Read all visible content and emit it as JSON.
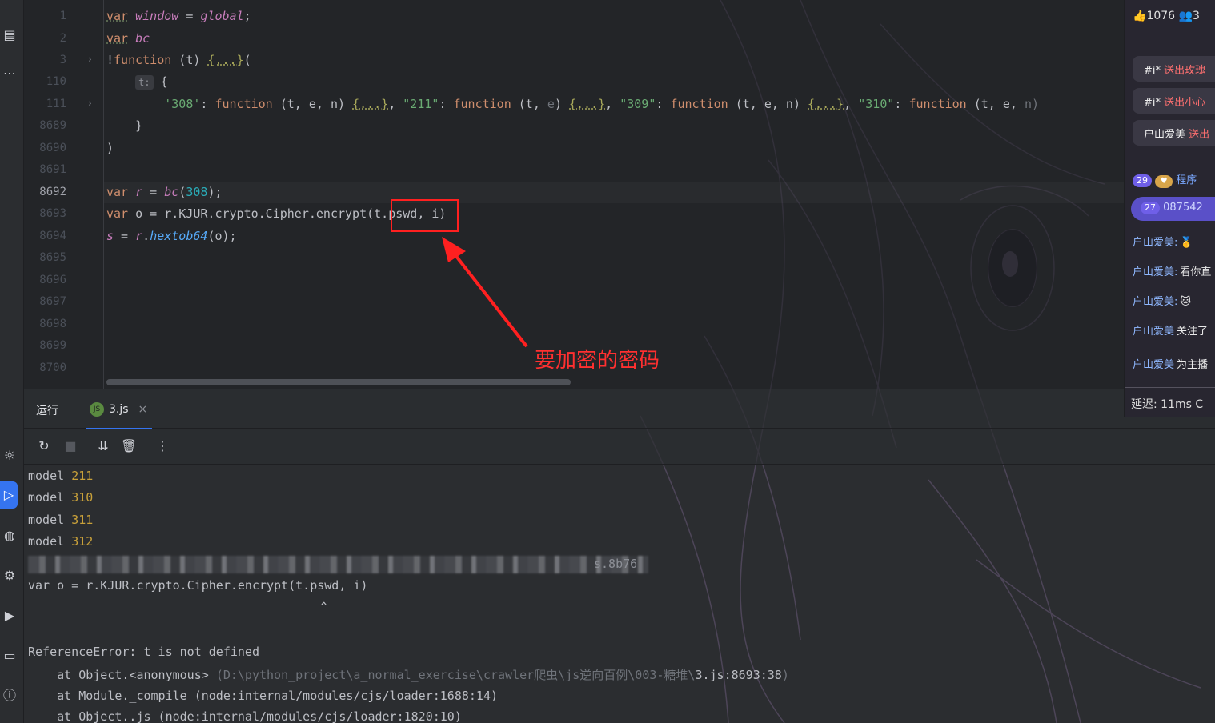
{
  "editor": {
    "lines": [
      {
        "num": "1"
      },
      {
        "num": "2"
      },
      {
        "num": "3"
      },
      {
        "num": "110"
      },
      {
        "num": "111"
      },
      {
        "num": "8689"
      },
      {
        "num": "8690"
      },
      {
        "num": "8691"
      },
      {
        "num": "8692"
      },
      {
        "num": "8693"
      },
      {
        "num": "8694"
      },
      {
        "num": "8695"
      },
      {
        "num": "8696"
      },
      {
        "num": "8697"
      },
      {
        "num": "8698"
      },
      {
        "num": "8699"
      },
      {
        "num": "8700"
      }
    ],
    "code": {
      "l1_kw": "var",
      "l1_name": "window",
      "l1_eq": " = ",
      "l1_val": "global",
      "l1_end": ";",
      "l2_kw": "var",
      "l2_name": "bc",
      "l3_start": "!",
      "l3_kw": "function",
      "l3_args": " (t) ",
      "l3_fold": "{...}",
      "l3_end": "(",
      "l110_hint": "t:",
      "l110_brace": "{",
      "l111_k1": "'308'",
      "l111_s1": ": ",
      "l111_f1": "function",
      "l111_a1": " (t, e, n) ",
      "l111_b1": "{...}",
      "l111_k2": "\"211\"",
      "l111_f2": "function",
      "l111_a2": " (t, ",
      "l111_e2": "e",
      "l111_a2b": ") ",
      "l111_b2": "{...}",
      "l111_k3": "\"309\"",
      "l111_f3": "function",
      "l111_a3": " (t, e, n) ",
      "l111_b3": "{...}",
      "l111_k4": "\"310\"",
      "l111_f4": "function",
      "l111_a4": " (t, e, ",
      "l111_n4": "n)",
      "l8689": "}",
      "l8690": ")",
      "l8692_kw": "var",
      "l8692_r": "r",
      "l8692_eq": " = ",
      "l8692_fn": "bc",
      "l8692_o": "(",
      "l8692_num": "308",
      "l8692_c": ");",
      "l8693_kw": "var",
      "l8693_rest": " o = r.KJUR.crypto.Cipher.encrypt(t.pswd, i)",
      "l8694_s": "s",
      "l8694_eq": " = ",
      "l8694_r": "r",
      "l8694_dot": ".",
      "l8694_fn": "hextob64",
      "l8694_end": "(o);"
    }
  },
  "annotation": {
    "text": "要加密的密码"
  },
  "run_panel": {
    "title": "运行",
    "tab_icon": "JS",
    "tab_label": "3.js",
    "close": "×"
  },
  "console": {
    "models": [
      {
        "label": "model",
        "value": "211"
      },
      {
        "label": "model",
        "value": "310"
      },
      {
        "label": "model",
        "value": "311"
      },
      {
        "label": "model",
        "value": "312"
      }
    ],
    "blur_tail": "s.8b76",
    "code_line": "var o = r.KJUR.crypto.Cipher.encrypt(t.pswd, i)",
    "caret": "^",
    "error": "ReferenceError: t is not defined",
    "stack1_a": "    at Object.<anonymous> ",
    "stack1_path": "(D:\\python_project\\a_normal_exercise\\crawler爬虫\\js逆向百例\\003-糖堆\\",
    "stack1_file": "3.js:8693:38",
    "stack1_close": ")",
    "stack2": "    at Module._compile (node:internal/modules/cjs/loader:1688:14)",
    "stack3": "    at Object..js (node:internal/modules/cjs/loader:1820:10)"
  },
  "chat": {
    "likes": "1076",
    "viewers": "3",
    "gifts": [
      {
        "user": "#i*",
        "text": "送出玫瑰"
      },
      {
        "user": "#i*",
        "text": "送出小心"
      },
      {
        "user": "户山爱美",
        "text": "送出"
      }
    ],
    "badge1": {
      "level": "29",
      "heart": "♥",
      "name": "程序"
    },
    "badge2": {
      "level": "27",
      "name": "087542"
    },
    "messages": [
      {
        "user": "户山爱美:",
        "text": "🥇"
      },
      {
        "user": "户山爱美:",
        "text": "看你直"
      },
      {
        "user": "户山爱美:",
        "text": "🐱"
      },
      {
        "user": "户山爱美",
        "text": "关注了"
      },
      {
        "user": "户山爱美",
        "text": "为主播"
      }
    ],
    "latency": "延迟: 11ms",
    "footer_c": "C"
  },
  "colors": {
    "accent": "#3574f0",
    "annotation": "#ff2020"
  }
}
